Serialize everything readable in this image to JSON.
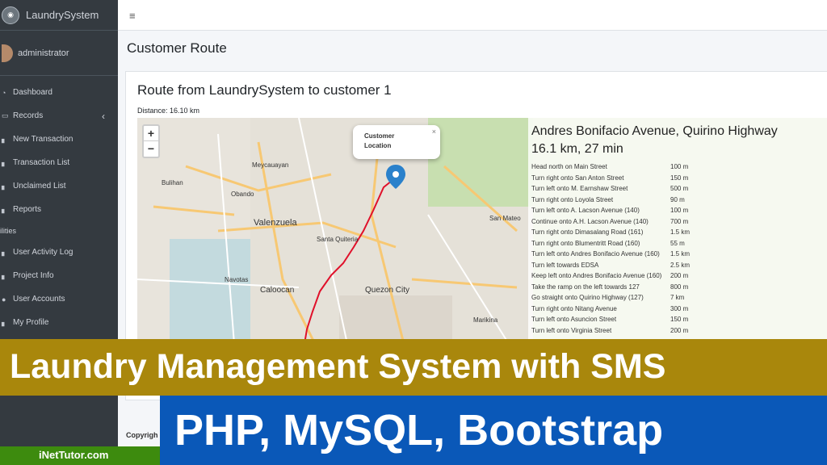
{
  "brand": {
    "title": "LaundrySystem"
  },
  "user": {
    "name": "administrator"
  },
  "sidebar": {
    "items": [
      {
        "label": "Dashboard",
        "icon": "dashboard-icon"
      },
      {
        "label": "Records",
        "icon": "records-icon"
      },
      {
        "label": "New Transaction",
        "icon": "chart-icon"
      },
      {
        "label": "Transaction List",
        "icon": "chart-icon"
      },
      {
        "label": "Unclaimed List",
        "icon": "chart-icon"
      },
      {
        "label": "Reports",
        "icon": "chart-icon"
      }
    ],
    "header": "ilities",
    "items2": [
      {
        "label": "User Activity Log",
        "icon": "chart-icon"
      },
      {
        "label": "Project Info",
        "icon": "chart-icon"
      },
      {
        "label": "User Accounts",
        "icon": "users-icon"
      },
      {
        "label": "My Profile",
        "icon": "chart-icon"
      }
    ]
  },
  "page": {
    "title": "Customer Route"
  },
  "card": {
    "title": "Route from LaundrySystem to customer 1",
    "distance": "Distance: 16.10 km"
  },
  "map": {
    "zoom_in": "+",
    "zoom_out": "−",
    "popup_line1": "Customer",
    "popup_line2": "Location",
    "popup_close": "×",
    "places": [
      {
        "name": "Obando"
      },
      {
        "name": "Valenzuela"
      },
      {
        "name": "Navotas"
      },
      {
        "name": "Caloocan"
      },
      {
        "name": "Quezon City"
      },
      {
        "name": "San Mateo"
      },
      {
        "name": "Marikina"
      },
      {
        "name": "Meycauayan"
      },
      {
        "name": "Santa Quiteria"
      },
      {
        "name": "Bulihan"
      }
    ]
  },
  "route": {
    "name": "Andres Bonifacio Avenue, Quirino Highway",
    "summary": "16.1 km, 27 min",
    "steps": [
      {
        "text": "Head north on Main Street",
        "dist": "100 m"
      },
      {
        "text": "Turn right onto San Anton Street",
        "dist": "150 m"
      },
      {
        "text": "Turn left onto M. Earnshaw Street",
        "dist": "500 m"
      },
      {
        "text": "Turn right onto Loyola Street",
        "dist": "90 m"
      },
      {
        "text": "Turn left onto A. Lacson Avenue (140)",
        "dist": "100 m"
      },
      {
        "text": "Continue onto A.H. Lacson Avenue (140)",
        "dist": "700 m"
      },
      {
        "text": "Turn right onto Dimasalang Road (161)",
        "dist": "1.5 km"
      },
      {
        "text": "Turn right onto Blumentritt Road (160)",
        "dist": "55 m"
      },
      {
        "text": "Turn left onto Andres Bonifacio Avenue (160)",
        "dist": "1.5 km"
      },
      {
        "text": "Turn left towards EDSA",
        "dist": "2.5 km"
      },
      {
        "text": "Keep left onto Andres Bonifacio Avenue (160)",
        "dist": "200 m"
      },
      {
        "text": "Take the ramp on the left towards 127",
        "dist": "800 m"
      },
      {
        "text": "Go straight onto Quirino Highway (127)",
        "dist": "7 km"
      },
      {
        "text": "Turn right onto Nitang Avenue",
        "dist": "300 m"
      },
      {
        "text": "Turn left onto Asuncion Street",
        "dist": "150 m"
      },
      {
        "text": "Turn left onto Virginia Street",
        "dist": "200 m"
      }
    ]
  },
  "footer": {
    "copyright": "Copyrigh"
  },
  "banners": {
    "title": "Laundry Management System with SMS",
    "tech": "PHP, MySQL, Bootstrap",
    "site": "iNetTutor.com"
  },
  "colors": {
    "sidebar": "#343a40",
    "route_line": "#e0102a",
    "banner_gold": "#a9870c",
    "banner_blue": "#0a58b8",
    "banner_green": "#3d8b0e"
  }
}
